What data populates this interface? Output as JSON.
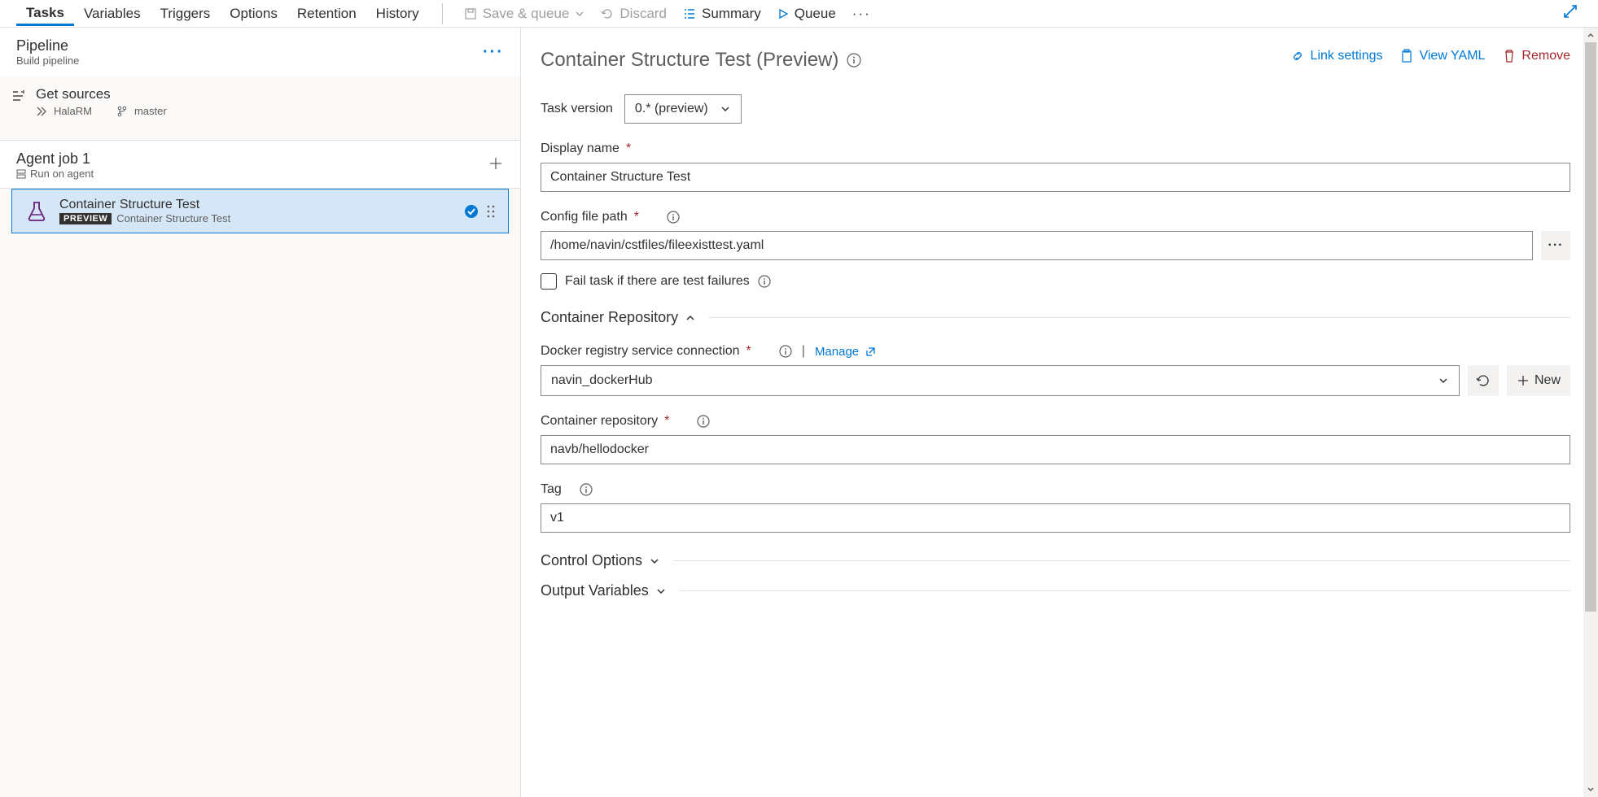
{
  "tabs": {
    "main": [
      "Tasks",
      "Variables",
      "Triggers",
      "Options",
      "Retention",
      "History"
    ],
    "active": "Tasks"
  },
  "toolbar": {
    "save_queue": "Save & queue",
    "discard": "Discard",
    "summary": "Summary",
    "queue": "Queue",
    "more": "···"
  },
  "pipeline": {
    "title": "Pipeline",
    "subtitle": "Build pipeline"
  },
  "sources": {
    "title": "Get sources",
    "repo": "HalaRM",
    "branch": "master"
  },
  "agent_job": {
    "title": "Agent job 1",
    "subtitle": "Run on agent"
  },
  "task": {
    "title": "Container Structure Test",
    "badge": "PREVIEW",
    "subtitle": "Container Structure Test"
  },
  "detail": {
    "title": "Container Structure Test (Preview)",
    "link_settings": "Link settings",
    "view_yaml": "View YAML",
    "remove": "Remove"
  },
  "form": {
    "task_version_label": "Task version",
    "task_version_value": "0.* (preview)",
    "display_name_label": "Display name",
    "display_name_value": "Container Structure Test",
    "config_path_label": "Config file path",
    "config_path_value": "/home/navin/cstfiles/fileexisttest.yaml",
    "fail_task_label": "Fail task if there are test failures",
    "container_repo_section": "Container Repository",
    "docker_conn_label": "Docker registry service connection",
    "docker_conn_value": "navin_dockerHub",
    "manage_link": "Manage",
    "container_repo_label": "Container repository",
    "container_repo_value": "navb/hellodocker",
    "tag_label": "Tag",
    "tag_value": "v1",
    "new_btn": "New",
    "control_options": "Control Options",
    "output_variables": "Output Variables"
  }
}
